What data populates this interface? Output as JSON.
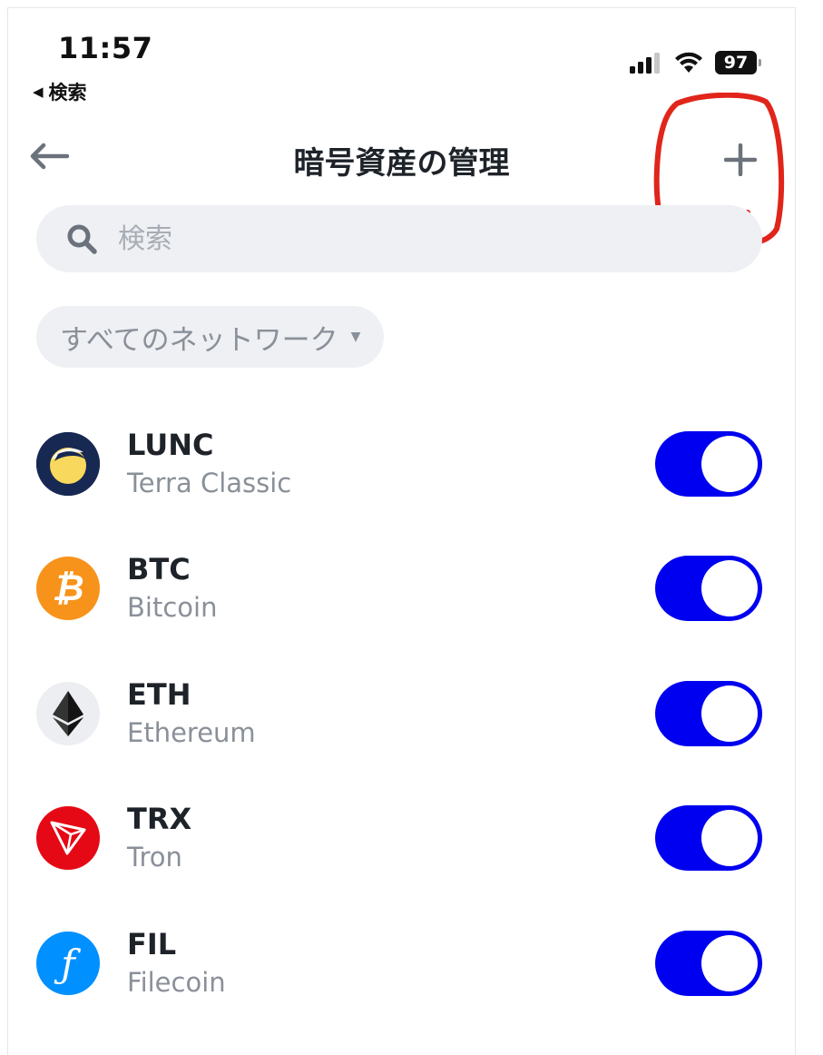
{
  "status_bar": {
    "time": "11:57",
    "back_to_app": "検索",
    "battery": "97"
  },
  "header": {
    "title": "暗号資産の管理"
  },
  "search": {
    "placeholder": "検索"
  },
  "network_filter": {
    "label": "すべてのネットワーク"
  },
  "assets": [
    {
      "symbol": "LUNC",
      "name": "Terra Classic",
      "enabled": true,
      "icon": "terra-classic-icon"
    },
    {
      "symbol": "BTC",
      "name": "Bitcoin",
      "enabled": true,
      "icon": "bitcoin-icon"
    },
    {
      "symbol": "ETH",
      "name": "Ethereum",
      "enabled": true,
      "icon": "ethereum-icon"
    },
    {
      "symbol": "TRX",
      "name": "Tron",
      "enabled": true,
      "icon": "tron-icon"
    },
    {
      "symbol": "FIL",
      "name": "Filecoin",
      "enabled": true,
      "icon": "filecoin-icon"
    }
  ],
  "colors": {
    "toggle_on": "#0000f0",
    "annotation": "#e0251b",
    "bitcoin": "#f7931a",
    "tron": "#e50915",
    "filecoin": "#0090ff",
    "terra": "#172852"
  }
}
